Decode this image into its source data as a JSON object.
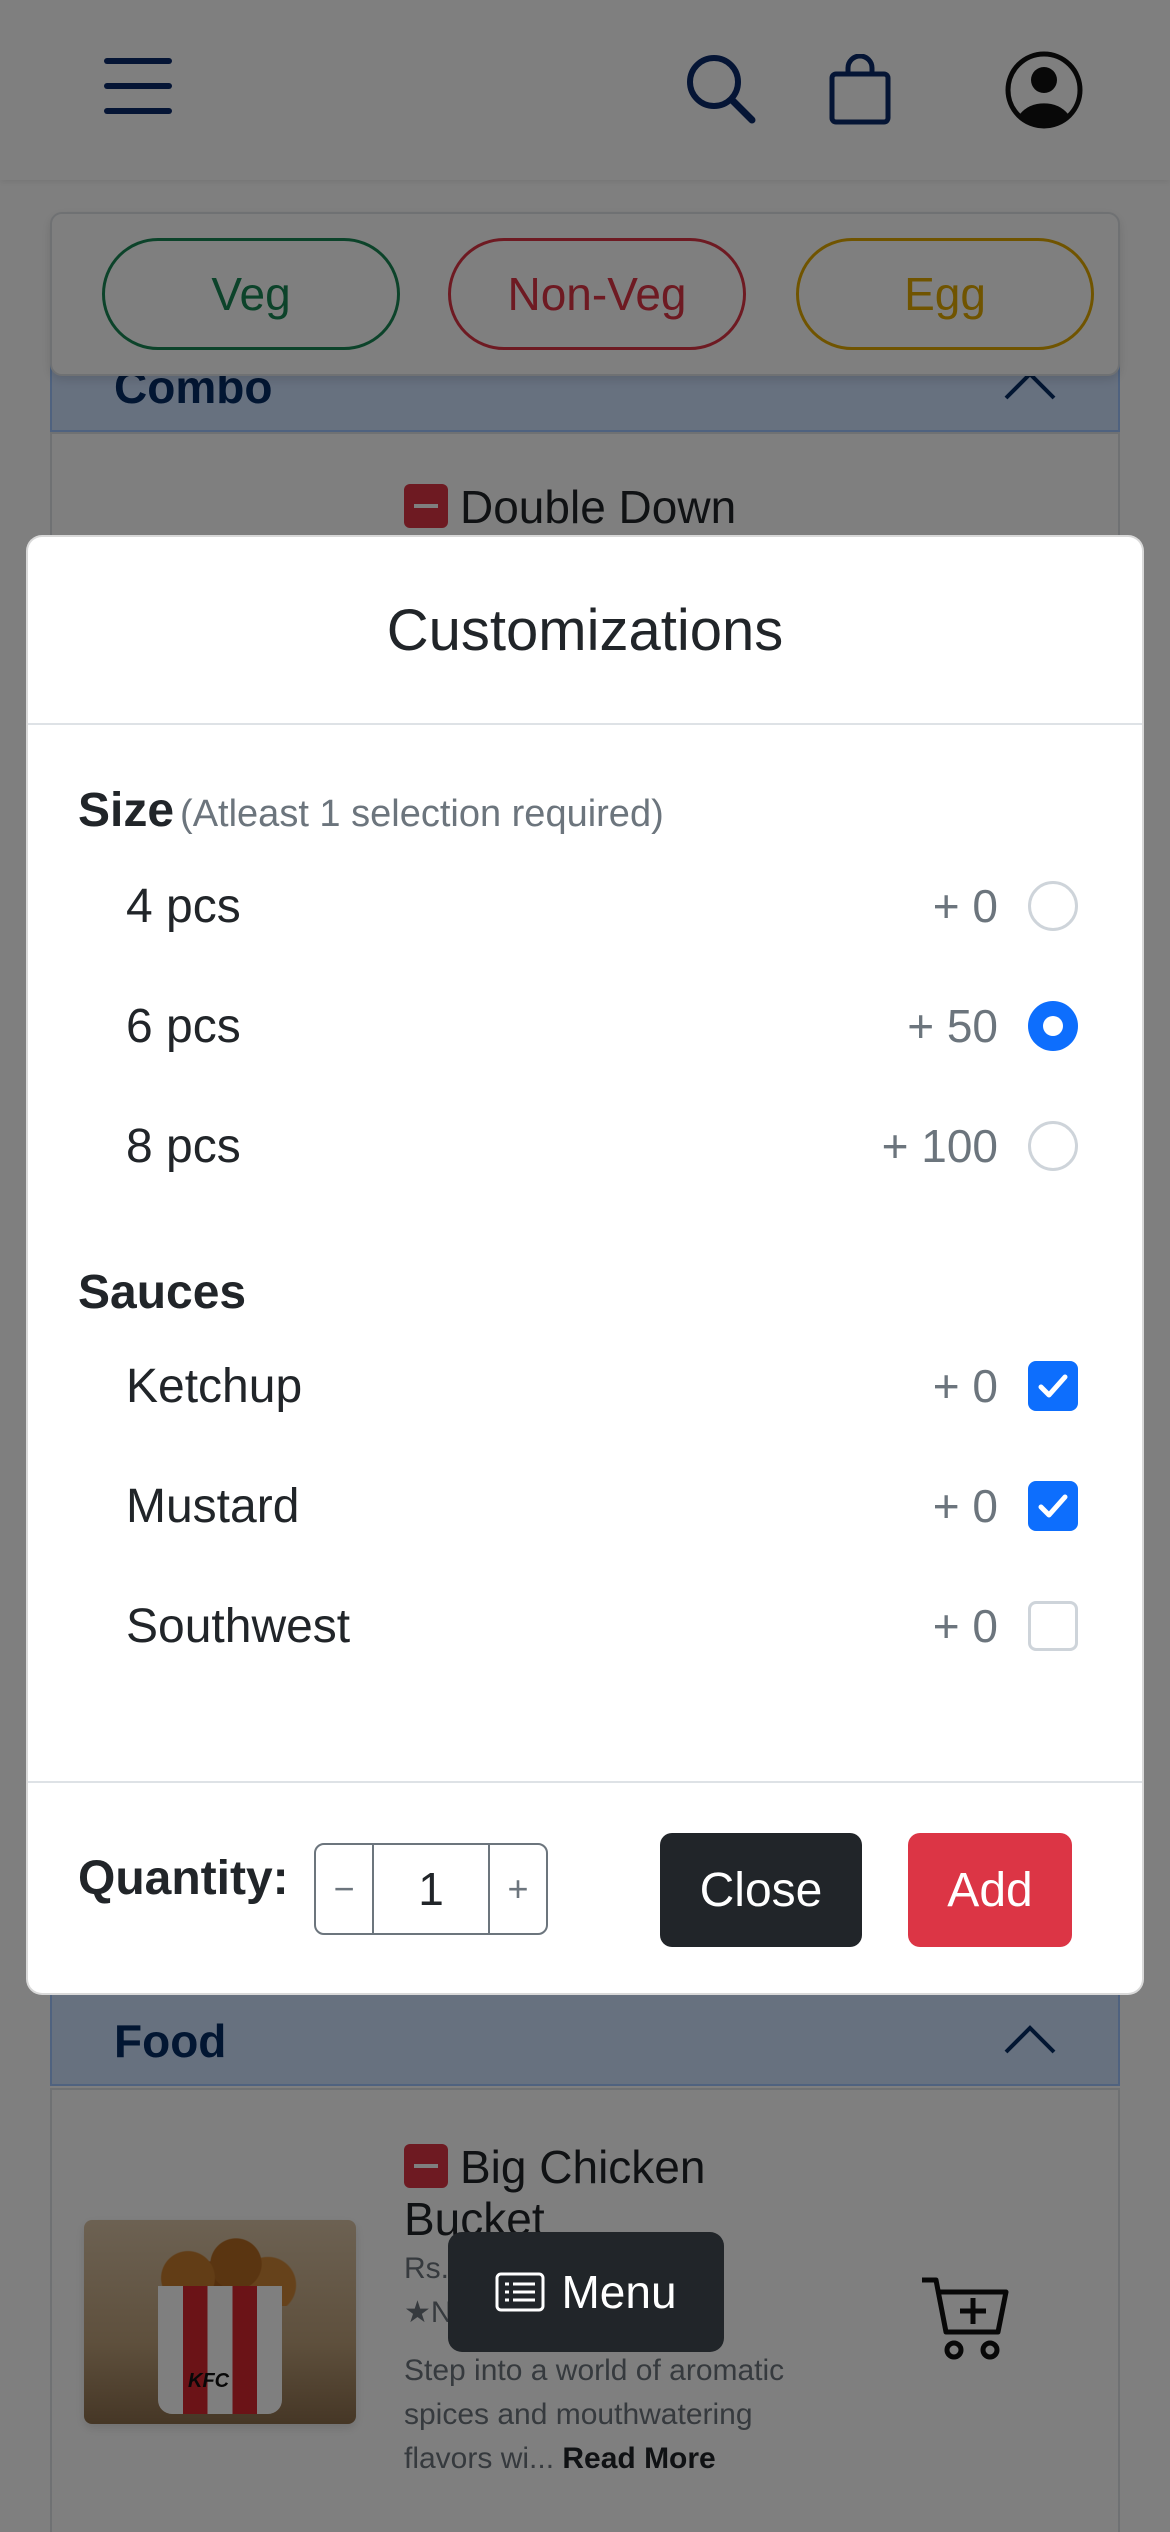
{
  "filters": {
    "veg": "Veg",
    "nonveg": "Non-Veg",
    "egg": "Egg"
  },
  "sections": {
    "combo": {
      "title": "Combo",
      "first_item": "Double Down"
    },
    "food": {
      "title": "Food",
      "item": {
        "name_line1": "Big Chicken",
        "name_line2": "Bucket",
        "price_prefix": "Rs.",
        "rating_prefix": "N",
        "description_line1": "Step into a world of aromatic",
        "description_line2": "spices and mouthwatering",
        "description_line3": "flavors wi...",
        "read_more": "Read More",
        "image_logo_text": "KFC"
      }
    }
  },
  "menu_button": {
    "label": "Menu"
  },
  "modal": {
    "title": "Customizations",
    "size_group": {
      "title": "Size",
      "note": "(Atleast 1 selection required)",
      "options": [
        {
          "label": "4 pcs",
          "price": "+ 0",
          "selected": false
        },
        {
          "label": "6 pcs",
          "price": "+ 50",
          "selected": true
        },
        {
          "label": "8 pcs",
          "price": "+ 100",
          "selected": false
        }
      ]
    },
    "sauces_group": {
      "title": "Sauces",
      "options": [
        {
          "label": "Ketchup",
          "price": "+ 0",
          "checked": true
        },
        {
          "label": "Mustard",
          "price": "+ 0",
          "checked": true
        },
        {
          "label": "Southwest",
          "price": "+ 0",
          "checked": false
        }
      ]
    },
    "footer": {
      "quantity_label": "Quantity:",
      "minus": "−",
      "quantity_value": "1",
      "plus": "+",
      "close_label": "Close",
      "add_label": "Add"
    }
  },
  "colors": {
    "primary": "#0d6efd",
    "danger": "#dc3545",
    "success": "#198754",
    "warning": "#e0a800",
    "dark": "#212529",
    "nav": "#0b2a6b"
  }
}
